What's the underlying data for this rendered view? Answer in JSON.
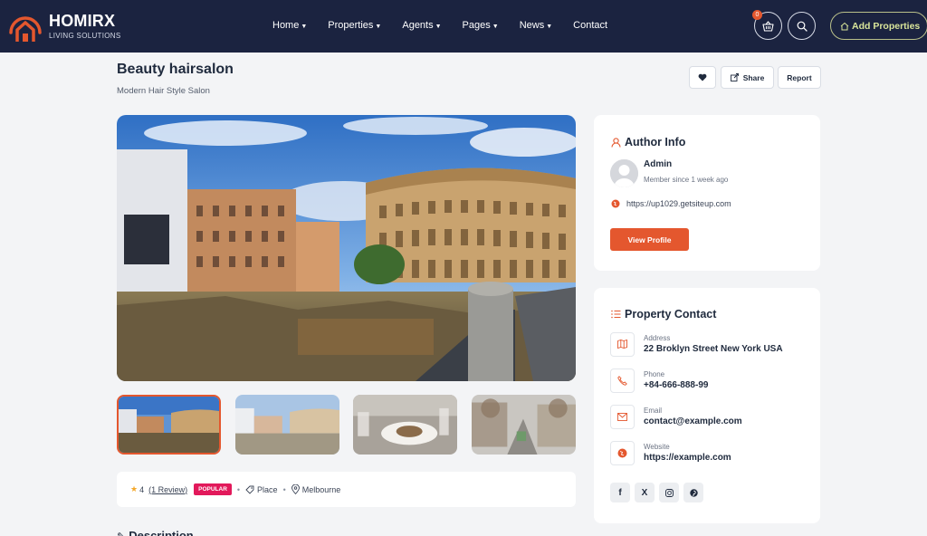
{
  "brand": {
    "name": "HOMIRX",
    "tagline": "LIVING SOLUTIONS",
    "accent": "#e4572e",
    "header_bg": "#1b2340"
  },
  "nav": [
    {
      "label": "Home",
      "dropdown": true
    },
    {
      "label": "Properties",
      "dropdown": true
    },
    {
      "label": "Agents",
      "dropdown": true
    },
    {
      "label": "Pages",
      "dropdown": true
    },
    {
      "label": "News",
      "dropdown": true
    },
    {
      "label": "Contact",
      "dropdown": false
    }
  ],
  "header_actions": {
    "cart_count": "0",
    "add_properties_label": "Add Properties"
  },
  "listing": {
    "title": "Beauty hairsalon",
    "subtitle": "Modern Hair Style Salon",
    "share_label": "Share",
    "report_label": "Report"
  },
  "gallery": {
    "hero_icon": "colosseum-photo",
    "thumbnails": [
      "colosseum-photo",
      "colosseum-photo-faded",
      "restaurant-dish-photo",
      "street-photo"
    ],
    "active_index": 0
  },
  "meta": {
    "rating": "4",
    "review_text": "(1 Review)",
    "badge": "POPULAR",
    "category": "Place",
    "location": "Melbourne"
  },
  "description_heading": "Description",
  "author": {
    "heading": "Author Info",
    "name": "Admin",
    "member_since": "Member since 1 week ago",
    "website": "https://up1029.getsiteup.com",
    "button_label": "View Profile"
  },
  "contact": {
    "heading": "Property Contact",
    "rows": [
      {
        "label": "Address",
        "value": "22 Broklyn Street New York USA",
        "icon": "map-icon"
      },
      {
        "label": "Phone",
        "value": "+84-666-888-99",
        "icon": "phone-icon"
      },
      {
        "label": "Email",
        "value": "contact@example.com",
        "icon": "mail-icon"
      },
      {
        "label": "Website",
        "value": "https://example.com",
        "icon": "globe-icon"
      }
    ],
    "socials": [
      "f",
      "X",
      "instagram-icon",
      "pinterest-icon"
    ]
  }
}
